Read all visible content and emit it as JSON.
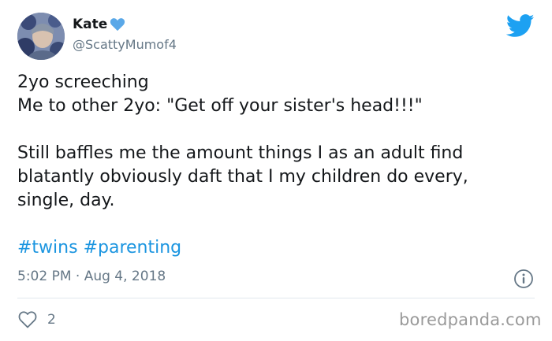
{
  "author": {
    "display_name": "Kate",
    "handle": "@ScattyMumof4"
  },
  "icons": {
    "heart": "blue-heart-icon",
    "bird": "twitter-bird-icon",
    "info": "info-icon",
    "like": "heart-outline-icon"
  },
  "tweet": {
    "lines": [
      "2yo screeching",
      "Me to other 2yo: \"Get off your sister's head!!!\"",
      "",
      "Still baffles me the amount things I as an adult find",
      "blatantly obviously daft that I my children do every,",
      "single, day."
    ],
    "hashtags": [
      "#twins",
      "#parenting"
    ],
    "timestamp": "5:02 PM · Aug 4, 2018"
  },
  "engagement": {
    "likes": "2"
  },
  "watermark": "boredpanda.com",
  "colors": {
    "link": "#1b95e0",
    "muted": "#657786",
    "text": "#14171a",
    "twitter_blue": "#1da1f2",
    "heart_blue": "#5aa8e8"
  }
}
